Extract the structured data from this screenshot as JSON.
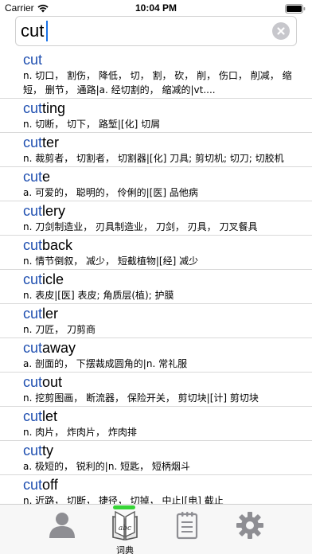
{
  "status_bar": {
    "carrier": "Carrier",
    "time": "10:04 PM"
  },
  "search": {
    "query": "cut",
    "highlight": "cut"
  },
  "entries": [
    {
      "prefix": "cut",
      "rest": "",
      "definition": "n. 切口， 割伤， 降低， 切， 割， 砍， 削， 伤口， 削减， 缩短， 删节， 通路|a. 经切割的， 缩减的|vt...."
    },
    {
      "prefix": "cut",
      "rest": "ting",
      "definition": "n. 切断， 切下， 路堑|[化] 切屑"
    },
    {
      "prefix": "cut",
      "rest": "ter",
      "definition": "n. 裁剪者， 切割者， 切割器|[化] 刀具; 剪切机; 切刀; 切胶机"
    },
    {
      "prefix": "cut",
      "rest": "e",
      "definition": "a. 可爱的， 聪明的， 伶俐的|[医] 品他病"
    },
    {
      "prefix": "cut",
      "rest": "lery",
      "definition": "n. 刀剑制造业， 刃具制造业， 刀剑， 刃具， 刀叉餐具"
    },
    {
      "prefix": "cut",
      "rest": "back",
      "definition": "n. 情节倒叙， 减少， 短截植物|[经] 减少"
    },
    {
      "prefix": "cut",
      "rest": "icle",
      "definition": "n. 表皮|[医] 表皮; 角质层(植); 护膜"
    },
    {
      "prefix": "cut",
      "rest": "ler",
      "definition": "n. 刀匠， 刀剪商"
    },
    {
      "prefix": "cut",
      "rest": "away",
      "definition": "a. 剖面的， 下摆裁成圆角的|n. 常礼服"
    },
    {
      "prefix": "cut",
      "rest": "out",
      "definition": "n. 挖剪图画， 断流器， 保险开关， 剪切块|[计] 剪切块"
    },
    {
      "prefix": "cut",
      "rest": "let",
      "definition": "n. 肉片， 炸肉片， 炸肉排"
    },
    {
      "prefix": "cut",
      "rest": "ty",
      "definition": "a. 极短的， 锐利的|n. 短匙， 短柄烟斗"
    },
    {
      "prefix": "cut",
      "rest": "off",
      "definition": "n. 近路， 切断， 捷径， 切掉， 中止|[电] 截止"
    }
  ],
  "tabs": [
    {
      "icon": "person-icon",
      "label": ""
    },
    {
      "icon": "dictionary-book-icon",
      "label": "词典",
      "selected": true
    },
    {
      "icon": "notepad-icon",
      "label": ""
    },
    {
      "icon": "gear-icon",
      "label": ""
    }
  ],
  "colors": {
    "highlight": "#1f4fb0",
    "tab_indicator": "#37d537",
    "icon_gray": "#8e8e93"
  }
}
